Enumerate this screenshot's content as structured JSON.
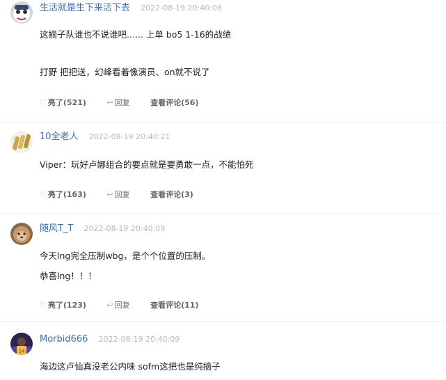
{
  "comments": [
    {
      "username": "生活就是生下来活下去",
      "time": "2022-08-19 20:40:08",
      "avatar": "avatar-white-mascot",
      "lines": [
        "这摘子队谁也不说谁吧...... 上单 bo5  1-16的战绩",
        "打野 把把送，幻峰看着像演员、on就不说了"
      ],
      "like_label": "亮了",
      "like_count": "(521)",
      "reply_label": "回复",
      "view_label": "查看评论",
      "view_count": "(56)"
    },
    {
      "username": "10全老人",
      "time": "2022-08-19 20:40:21",
      "avatar": "avatar-gold-bars",
      "lines": [
        "Viper：玩好卢娜组合的要点就是要勇敢一点，不能怕死"
      ],
      "like_label": "亮了",
      "like_count": "(163)",
      "reply_label": "回复",
      "view_label": "查看评论",
      "view_count": "(3)"
    },
    {
      "username": "随风T_T",
      "time": "2022-08-19 20:40:09",
      "avatar": "avatar-lion",
      "lines": [
        "今天lng完全压制wbg，是个个位置的压制。",
        "恭喜lng！！！"
      ],
      "like_label": "亮了",
      "like_count": "(123)",
      "reply_label": "回复",
      "view_label": "查看评论",
      "view_count": "(11)"
    },
    {
      "username": "Morbid666",
      "time": "2022-08-19 20:40:09",
      "avatar": "avatar-player-photo",
      "lines": [
        "海边这卢仙真没老公内味 sofm这把也是纯摘子"
      ]
    }
  ],
  "icons": {
    "like": "thumb-icon",
    "reply": "reply-arrow-icon"
  },
  "colors": {
    "username": "#3c6fb4",
    "time": "#b4b8c0",
    "divider": "#eceef2"
  }
}
